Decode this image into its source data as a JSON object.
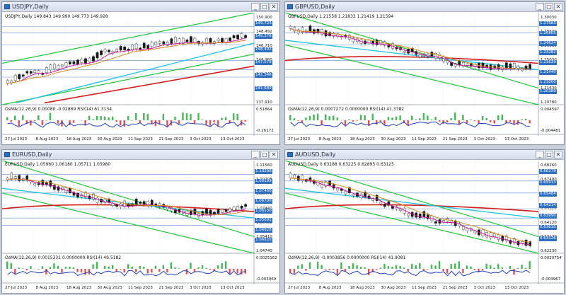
{
  "colors": {
    "bg": "#ffffff",
    "grid": "#d7dde7",
    "bull": "#1a1a1a",
    "bear": "#1a1a1a",
    "ma_magenta": "#c8189a",
    "ma_orange": "#d38b1c",
    "ma_cyan": "#27c5e0",
    "ma_red": "#d41c1c",
    "channel_green": "#21c43b",
    "hline": "#5b8ccf",
    "osma_green": "#49b85a",
    "osma_red": "#e3545a",
    "rsi_blue": "#1d3fb5"
  },
  "windows": [
    {
      "id": "usdjpy",
      "title": "USDJPY,Daily",
      "info": "USDJPY,Daily  149.843 149.990 149.773 149.928",
      "osc_info": "OsMA(12,26,9) 0.00080 -0.02869  RSI(14) 61.3134",
      "prices": [
        "150.900",
        "148.492",
        "146.710",
        "144.960",
        "141.245",
        "139.660",
        "137.910"
      ],
      "tags": [
        "149.723",
        "149.378",
        "148.492",
        "147.578",
        "141.346",
        "141.689"
      ],
      "osc_prices": [
        "0.51864",
        "-0.26172"
      ],
      "dates": [
        "27 Jul 2023",
        "8 Aug 2023",
        "18 Aug 2023",
        "30 Aug 2023",
        "11 Sep 2023",
        "21 Sep 2023",
        "3 Oct 2023",
        "13 Oct 2023"
      ],
      "icons": [
        "window-icon"
      ]
    },
    {
      "id": "gbpusd",
      "title": "GBPUSD,Daily",
      "info": "GBPUSD,Daily  1.21558 1.21833 1.21419 1.21594",
      "osc_info": "OsMA(12,26,9) 0.0007272 0.0000000  RSI(14) 41.3782",
      "prices": [
        "1.30030",
        "1.28630",
        "1.26810",
        "1.25030",
        "1.23430",
        "1.21630",
        "1.20780"
      ],
      "tags": [
        "1.27583",
        "1.26805",
        "1.24624",
        "1.23282",
        "1.21639",
        "1.21440",
        "1.21000",
        "1.20389"
      ],
      "osc_prices": [
        "0.004597",
        "-0.004481"
      ],
      "dates": [
        "27 Jul 2023",
        "8 Aug 2023",
        "18 Aug 2023",
        "30 Aug 2023",
        "11 Sep 2023",
        "21 Sep 2023",
        "3 Oct 2023",
        "13 Oct 2023"
      ],
      "icons": [
        "window-icon"
      ]
    },
    {
      "id": "eurusd",
      "title": "EURUSD,Daily",
      "info": "EURUSD,Daily  1.05960 1.06180 1.05711 1.05980",
      "osc_info": "OsMA(12,26,9) 0.0015331 0.0000000  RSI(14) 49.5182",
      "prices": [
        "1.11560",
        "1.10298",
        "1.08470",
        "1.07440",
        "1.06400",
        "1.05410",
        "1.04740"
      ],
      "tags": [
        "1.10298",
        "1.09199",
        "1.07466",
        "1.06700",
        "1.06130",
        "1.05691",
        "1.04928",
        "1.04520"
      ],
      "osc_prices": [
        "0.0025162",
        "-0.003969"
      ],
      "dates": [
        "27 Jul 2023",
        "8 Aug 2023",
        "18 Aug 2023",
        "30 Aug 2023",
        "11 Sep 2023",
        "21 Sep 2023",
        "3 Oct 2023",
        "13 Oct 2023"
      ],
      "icons": [
        "window-icon"
      ]
    },
    {
      "id": "audusd",
      "title": "AUDUSD,Daily",
      "info": "AUDUSD,Daily  0.63188 0.63225 0.62895 0.63125",
      "osc_info": "OsMA(12,26,9) -0.0003856 0.0000000  RSI(14) 41.9081",
      "prices": [
        "0.68260",
        "0.67400",
        "0.66320",
        "0.65120",
        "0.64120",
        "0.63120",
        "0.62230"
      ],
      "tags": [
        "0.66279",
        "0.65913",
        "0.65484",
        "0.64214",
        "0.63990",
        "0.63630",
        "0.63126"
      ],
      "osc_prices": [
        "0.0020754",
        "-0.003967"
      ],
      "dates": [
        "27 Jul 2023",
        "8 Aug 2023",
        "18 Aug 2023",
        "30 Aug 2023",
        "11 Sep 2023",
        "21 Sep 2023",
        "3 Oct 2023",
        "13 Oct 2023"
      ],
      "icons": [
        "window-icon"
      ]
    }
  ],
  "buttons": {
    "minimize": "_",
    "maximize": "□",
    "close": "✕"
  }
}
